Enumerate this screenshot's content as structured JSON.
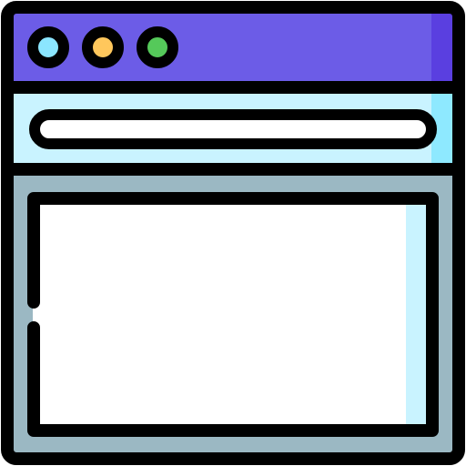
{
  "window": {
    "icon": "browser-window-icon",
    "traffic_lights": [
      {
        "name": "close",
        "color": "#8be6ff"
      },
      {
        "name": "minimize",
        "color": "#ffc75c"
      },
      {
        "name": "maximize",
        "color": "#55c95a"
      }
    ],
    "colors": {
      "outline": "#000000",
      "title_bar": "#6c5ce7",
      "title_bar_shade": "#5a3fe0",
      "address_bar_area": "#c9f3ff",
      "address_bar_area_shade": "#8ee9ff",
      "address_field": "#ffffff",
      "content_frame": "#9bb8c3",
      "content_panel": "#ffffff",
      "content_panel_shade": "#c9f3ff"
    },
    "address_field": {
      "value": ""
    }
  }
}
